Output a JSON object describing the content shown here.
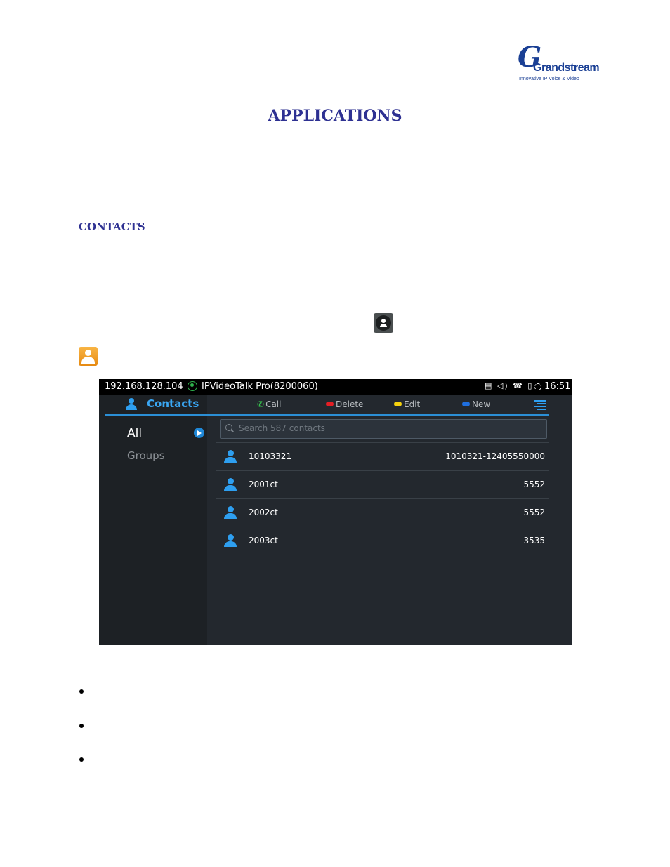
{
  "logo": {
    "text": "Grandstream",
    "tagline": "Innovative IP Voice & Video"
  },
  "heading": "APPLICATIONS",
  "section": "CONTACTS",
  "icons": {
    "contacts_dark": "contacts-app-icon",
    "contacts_orange": "contacts-app-icon-legacy"
  },
  "device": {
    "status": {
      "ip": "192.168.128.104",
      "account": "IPVideoTalk Pro(8200060)",
      "time": "16:51",
      "icons": "▤ ◁) ☎ ▯"
    },
    "toolbar": {
      "title": "Contacts",
      "call": "Call",
      "delete": "Delete",
      "edit": "Edit",
      "new": "New"
    },
    "colors": {
      "call": "#37c24d",
      "delete": "#e41e24",
      "edit": "#f5d20e",
      "new": "#1f6fe0",
      "accent": "#2e9ff0"
    },
    "nav": {
      "all": "All",
      "groups": "Groups"
    },
    "search": {
      "placeholder": "Search 587 contacts"
    },
    "contacts": [
      {
        "name": "10103321",
        "number": "1010321-12405550000"
      },
      {
        "name": "2001ct",
        "number": "5552"
      },
      {
        "name": "2002ct",
        "number": "5552"
      },
      {
        "name": "2003ct",
        "number": "3535"
      }
    ]
  },
  "bullets": [
    "",
    "",
    ""
  ]
}
